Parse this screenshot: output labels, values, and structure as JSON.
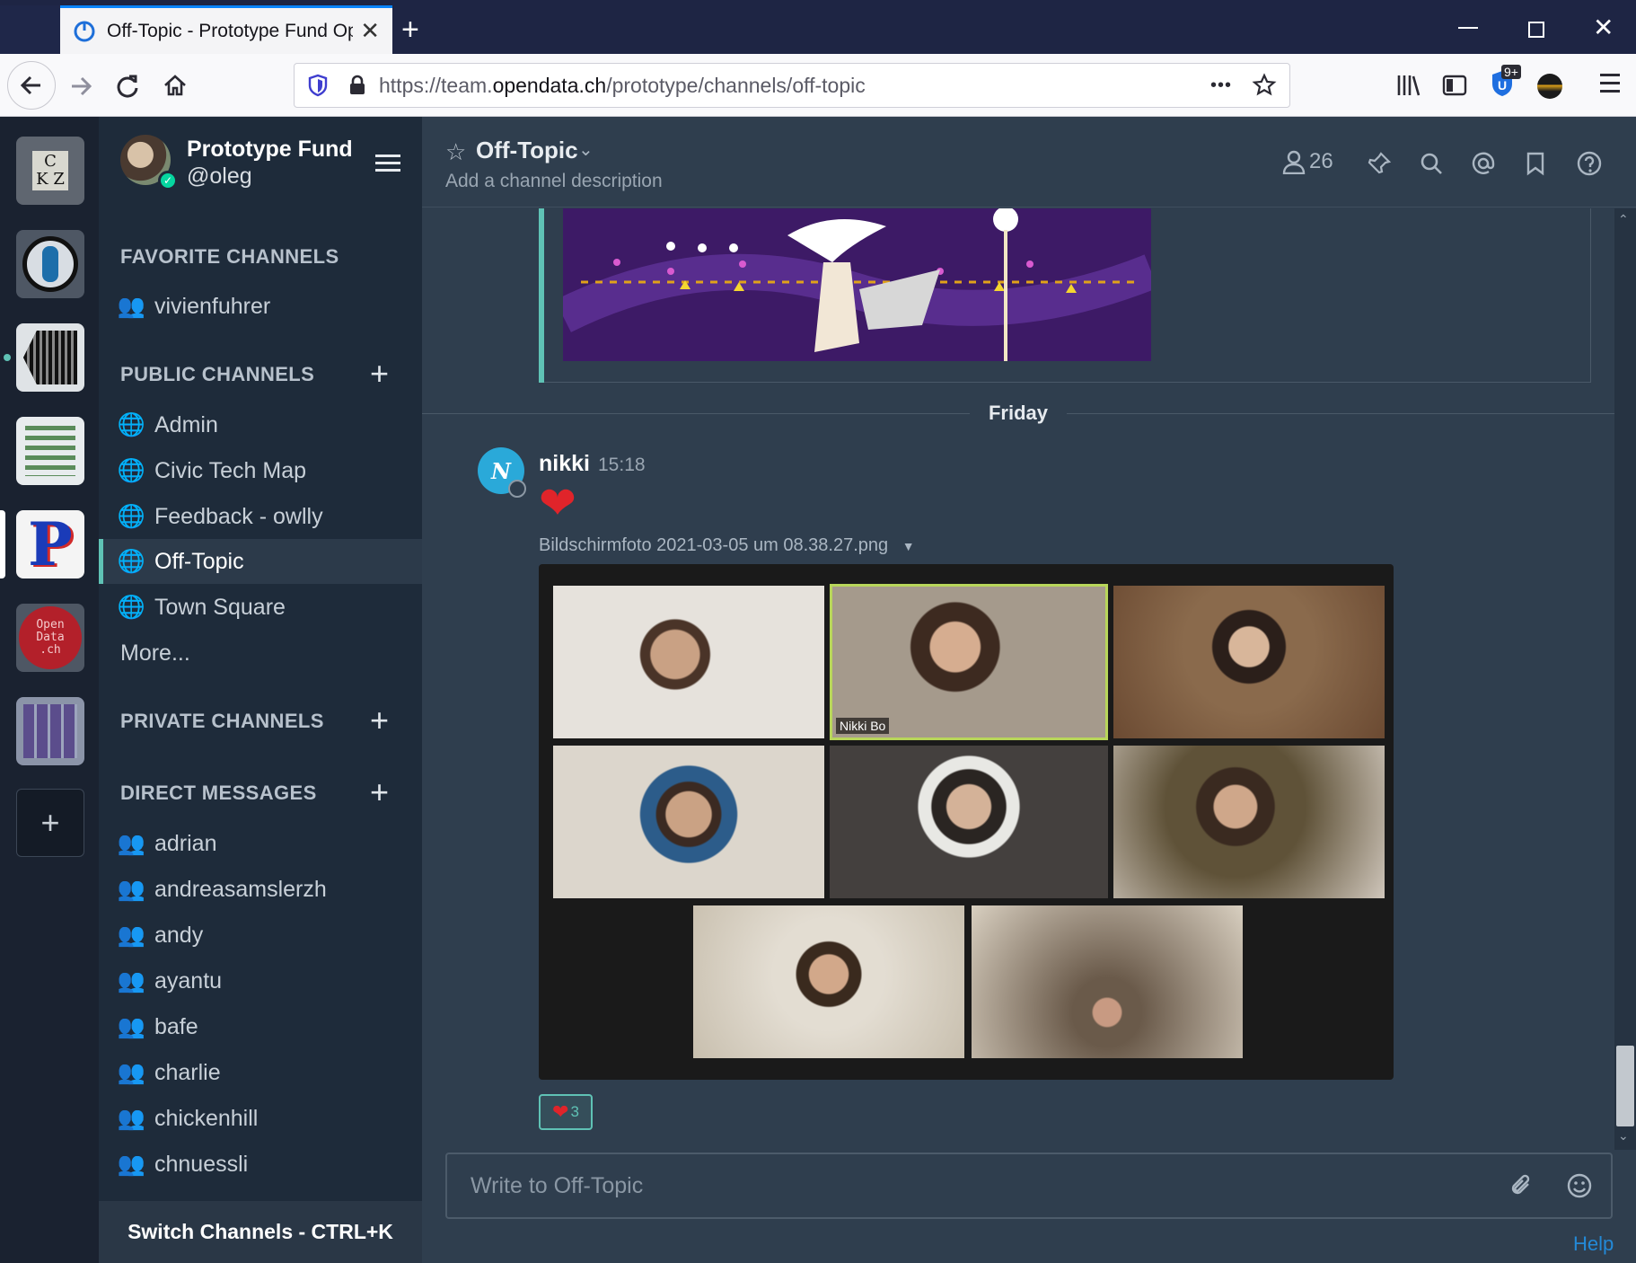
{
  "browser": {
    "tab_title": "Off-Topic - Prototype Fund Op",
    "new_tab": "+",
    "url_prefix": "https://team.",
    "url_domain": "opendata.ch",
    "url_path": "/prototype/channels/off-topic",
    "more_label": "•••",
    "extension_badge": "9+"
  },
  "team_sidebar": {
    "teams": [
      {
        "name": "ckz-team",
        "label": "C K Z"
      },
      {
        "name": "team-2",
        "label": ""
      },
      {
        "name": "team-3",
        "label": ""
      },
      {
        "name": "team-4",
        "label": ""
      },
      {
        "name": "prototype-fund-team",
        "label": "P"
      },
      {
        "name": "opendata-team",
        "label": "Open Data .ch"
      },
      {
        "name": "team-7",
        "label": ""
      }
    ],
    "add_team": "+"
  },
  "sidebar": {
    "team_name": "Prototype Fund",
    "username": "@oleg",
    "favorite_title": "FAVORITE CHANNELS",
    "favorites": [
      {
        "label": "vivienfuhrer"
      }
    ],
    "public_title": "PUBLIC CHANNELS",
    "public": [
      {
        "label": "Admin"
      },
      {
        "label": "Civic Tech Map"
      },
      {
        "label": "Feedback - owlly"
      },
      {
        "label": "Off-Topic"
      },
      {
        "label": "Town Square"
      }
    ],
    "more": "More...",
    "private_title": "PRIVATE CHANNELS",
    "dm_title": "DIRECT MESSAGES",
    "dms": [
      {
        "label": "adrian"
      },
      {
        "label": "andreasamslerzh"
      },
      {
        "label": "andy"
      },
      {
        "label": "ayantu"
      },
      {
        "label": "bafe"
      },
      {
        "label": "charlie"
      },
      {
        "label": "chickenhill"
      },
      {
        "label": "chnuessli"
      }
    ],
    "switch_channels": "Switch Channels - CTRL+K"
  },
  "channel": {
    "name": "Off-Topic",
    "description": "Add a channel description",
    "member_count": "26"
  },
  "messages": {
    "date_separator": "Friday",
    "author_initial": "N",
    "author": "nikki",
    "time": "15:18",
    "emoji": "❤",
    "attachment_name": "Bildschirmfoto 2021-03-05 um 08.38.27.png",
    "video_caption": "Nikki Bo",
    "reaction_emoji": "❤",
    "reaction_count": "3"
  },
  "composer": {
    "placeholder": "Write to Off-Topic"
  },
  "footer": {
    "help": "Help"
  },
  "colors": {
    "accent": "#5fc2b5",
    "sidebar_bg": "#1e2b3a",
    "center_bg": "#2f3e4e",
    "link": "#2389d7"
  }
}
